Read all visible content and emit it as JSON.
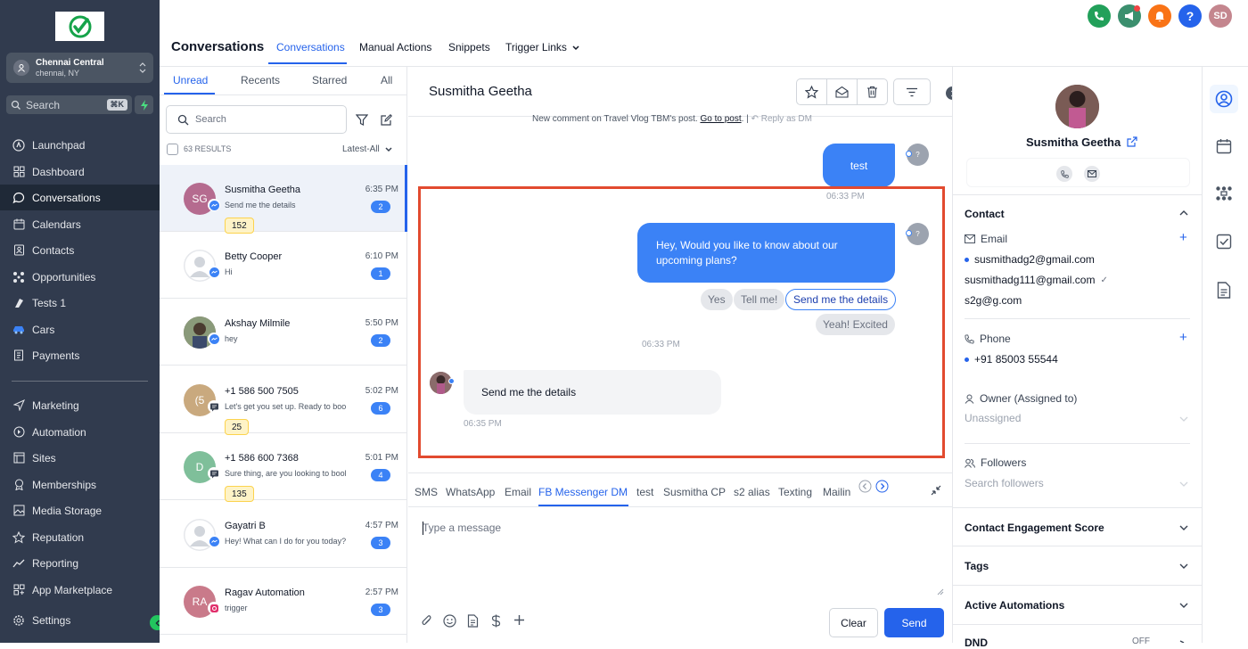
{
  "sidebar": {
    "location": {
      "name": "Chennai Central",
      "sub": "chennai, NY"
    },
    "search": {
      "placeholder": "Search",
      "shortcut": "⌘K"
    },
    "nav": [
      {
        "label": "Launchpad",
        "icon": "rocket-icon"
      },
      {
        "label": "Dashboard",
        "icon": "grid-icon"
      },
      {
        "label": "Conversations",
        "icon": "chat-icon",
        "active": true
      },
      {
        "label": "Calendars",
        "icon": "calendar-icon"
      },
      {
        "label": "Contacts",
        "icon": "contacts-icon"
      },
      {
        "label": "Opportunities",
        "icon": "pipeline-icon"
      },
      {
        "label": "Tests 1",
        "icon": "flask-icon"
      },
      {
        "label": "Cars",
        "icon": "car-icon"
      },
      {
        "label": "Payments",
        "icon": "receipt-icon"
      }
    ],
    "nav2": [
      {
        "label": "Marketing",
        "icon": "send-icon"
      },
      {
        "label": "Automation",
        "icon": "automation-icon"
      },
      {
        "label": "Sites",
        "icon": "sites-icon"
      },
      {
        "label": "Memberships",
        "icon": "membership-icon"
      },
      {
        "label": "Media Storage",
        "icon": "image-icon"
      },
      {
        "label": "Reputation",
        "icon": "star-icon"
      },
      {
        "label": "Reporting",
        "icon": "chart-icon"
      },
      {
        "label": "App Marketplace",
        "icon": "apps-icon"
      }
    ],
    "settings": "Settings"
  },
  "header": {
    "title": "Conversations",
    "tabs": [
      "Conversations",
      "Manual Actions",
      "Snippets",
      "Trigger Links"
    ],
    "avatar_initials": "SD"
  },
  "list": {
    "tabs": [
      "Unread",
      "Recents",
      "Starred",
      "All"
    ],
    "search_placeholder": "Search",
    "results": "63 RESULTS",
    "sort": "Latest-All",
    "items": [
      {
        "initials": "SG",
        "name": "Susmitha Geetha",
        "preview": "Send me the details",
        "time": "6:35 PM",
        "count": "2",
        "badge": "152",
        "color": "#b56b8f",
        "channel": "messenger"
      },
      {
        "initials": "",
        "name": "Betty Cooper",
        "preview": "Hi",
        "time": "6:10 PM",
        "count": "1",
        "badge": "",
        "color": "#e5e7eb",
        "channel": "messenger"
      },
      {
        "initials": "",
        "name": "Akshay Milmile",
        "preview": "hey",
        "time": "5:50 PM",
        "count": "2",
        "badge": "",
        "color": "#7a6a5a",
        "channel": "messenger"
      },
      {
        "initials": "(5",
        "name": "+1 586 500 7505",
        "preview": "Let's get you set up. Ready to boo",
        "time": "5:02 PM",
        "count": "6",
        "badge": "25",
        "color": "#c9a97e",
        "channel": "sms"
      },
      {
        "initials": "D",
        "name": "+1 586 600 7368",
        "preview": "Sure thing, are you looking to bool",
        "time": "5:01 PM",
        "count": "4",
        "badge": "135",
        "color": "#7fbf9a",
        "channel": "sms"
      },
      {
        "initials": "",
        "name": "Gayatri B",
        "preview": "Hey! What can I do for you today?",
        "time": "4:57 PM",
        "count": "3",
        "badge": "",
        "color": "#e5e7eb",
        "channel": "messenger"
      },
      {
        "initials": "RA",
        "name": "Ragav Automation",
        "preview": "trigger",
        "time": "2:57 PM",
        "count": "3",
        "badge": "",
        "color": "#c97a8a",
        "channel": "instagram"
      }
    ]
  },
  "chat": {
    "name": "Susmitha Geetha",
    "notice": {
      "text": "New comment on Travel Vlog TBM's post.",
      "link": "Go to post",
      "sep": ". |",
      "reply": "Reply as DM"
    },
    "out1": {
      "text": "test",
      "time": "06:33 PM"
    },
    "out2": {
      "text": "Hey, Would you like to know about our upcoming plans?",
      "time": "06:33 PM"
    },
    "quick_replies": [
      "Yes",
      "Tell me!",
      "Send me the details",
      "Yeah! Excited"
    ],
    "in1": {
      "text": "Send me the details",
      "time": "06:35 PM"
    },
    "agent_avatar": "?",
    "channels": [
      "SMS",
      "WhatsApp",
      "Email",
      "FB Messenger DM",
      "test",
      "Susmitha CP",
      "s2 alias",
      "Texting",
      "Mailin"
    ],
    "compose_placeholder": "Type a message",
    "clear": "Clear",
    "send": "Send"
  },
  "contact": {
    "name": "Susmitha Geetha",
    "section": "Contact",
    "email_label": "Email",
    "emails": [
      "susmithadg2@gmail.com",
      "susmithadg111@gmail.com",
      "s2g@g.com"
    ],
    "phone_label": "Phone",
    "phone": "+91 85003 55544",
    "owner_label": "Owner (Assigned to)",
    "owner_value": "Unassigned",
    "followers_label": "Followers",
    "followers_placeholder": "Search followers",
    "sections": [
      "Contact Engagement Score",
      "Tags",
      "Active Automations",
      "DND"
    ],
    "dnd_value": "OFF"
  },
  "colors": {
    "accent": "#2563eb",
    "sidebar": "#313b4e",
    "highlight": "#e24a2f"
  }
}
